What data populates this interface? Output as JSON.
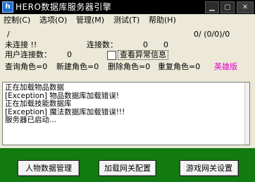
{
  "window": {
    "title": "HERO数据库服务器引擎",
    "icon": "h"
  },
  "menu": [
    {
      "label": "控制(C)"
    },
    {
      "label": "选项(O)"
    },
    {
      "label": "管理(M)"
    },
    {
      "label": "测试(T)"
    },
    {
      "label": "帮助(H)"
    }
  ],
  "status": {
    "path_text": "/",
    "counter_text": "0/ (0/0)/0",
    "connection_status": "未连接 !!",
    "connections_label": "连接数：",
    "connections_value": "0",
    "connections_value2": "0",
    "user_connections_label": "用户连接数：",
    "user_connections_value": "0",
    "view_errors_label": "查看异常信息",
    "query_roles": "查询角色=0",
    "new_roles": "新建角色=0",
    "delete_roles": "删除角色=0",
    "rename_roles": "重复角色=0",
    "edition": "英雄版"
  },
  "log": {
    "lines": [
      "正在加载物品数据",
      "[Exception] 物品数据库加载错误!",
      "正在加载技能数据库",
      "[Exception] 魔法数据库加载错误!!!",
      "服务器已启动..."
    ]
  },
  "buttons": {
    "character_data": "人物数据管理",
    "gateway_config": "加载网关配置",
    "game_gateway": "游戏网关设置"
  },
  "colors": {
    "titlebar": "#000000",
    "bottom_panel": "#117a11",
    "edition_text": "#e000c8"
  }
}
